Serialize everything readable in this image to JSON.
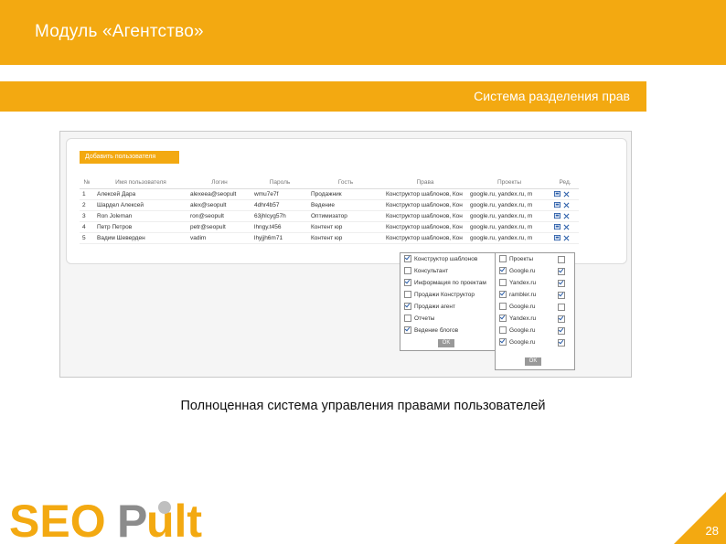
{
  "header": {
    "title": "Модуль «Агентство»"
  },
  "subheader": {
    "title": "Система разделения прав"
  },
  "screenshot": {
    "add_button": "Добавить пользователя",
    "columns": [
      "№",
      "Имя пользователя",
      "Логин",
      "Пароль",
      "Гость",
      "Права",
      "Проекты",
      "Ред."
    ],
    "rows": [
      {
        "num": "1",
        "name": "Алексей Дара",
        "login": "alexeea@seopult",
        "password": "wmu7e7f",
        "guest": "Продажник",
        "rights": "Конструктор шаблонов, Кон",
        "projects": "google.ru, yandex.ru, m"
      },
      {
        "num": "2",
        "name": "Шардел Алексей",
        "login": "alex@seopult",
        "password": "4dhr4b57",
        "guest": "Ведение",
        "rights": "Конструктор шаблонов, Кон",
        "projects": "google.ru, yandex.ru, m"
      },
      {
        "num": "3",
        "name": "Ron Joleman",
        "login": "ron@seopult",
        "password": "63jhlcyg57h",
        "guest": "Оптимизатор",
        "rights": "Конструктор шаблонов, Кон",
        "projects": "google.ru, yandex.ru, m"
      },
      {
        "num": "4",
        "name": "Петр Петров",
        "login": "petr@seopult",
        "password": "lhngy.t456",
        "guest": "Контент юр",
        "rights": "Конструктор шаблонов, Кон",
        "projects": "google.ru, yandex.ru, m"
      },
      {
        "num": "5",
        "name": "Вадим Шеверден",
        "login": "vadim",
        "password": "lhyjjh6m71",
        "guest": "Контент юр",
        "rights": "Конструктор шаблонов, Кон",
        "projects": "google.ru, yandex.ru, m"
      }
    ],
    "rights_dropdown": {
      "items": [
        {
          "label": "Конструктор шаблонов",
          "checked": true
        },
        {
          "label": "Консультант",
          "checked": false
        },
        {
          "label": "Информация по проектам",
          "checked": true
        },
        {
          "label": "Продажи Конструктор",
          "checked": false
        },
        {
          "label": "Продажи агент",
          "checked": true
        },
        {
          "label": "Отчеты",
          "checked": false
        },
        {
          "label": "Ведение блогов",
          "checked": true
        }
      ],
      "ok": "OK"
    },
    "projects_dropdown": {
      "items": [
        {
          "label": "Проекты",
          "checked": false,
          "edit": false
        },
        {
          "label": "Google.ru",
          "checked": true,
          "edit": true
        },
        {
          "label": "Yandex.ru",
          "checked": false,
          "edit": true
        },
        {
          "label": "rambler.ru",
          "checked": true,
          "edit": true
        },
        {
          "label": "Google.ru",
          "checked": false,
          "edit": false
        },
        {
          "label": "Yandex.ru",
          "checked": true,
          "edit": true
        },
        {
          "label": "Google.ru",
          "checked": false,
          "edit": true
        },
        {
          "label": "Google.ru",
          "checked": true,
          "edit": true
        }
      ],
      "ok": "OK"
    }
  },
  "caption": "Полноценная система управления правами пользователей",
  "logo_text": "SEOPult",
  "page_number": "28",
  "colors": {
    "accent": "#f3a911",
    "logo_gray": "#8c8c8c"
  }
}
